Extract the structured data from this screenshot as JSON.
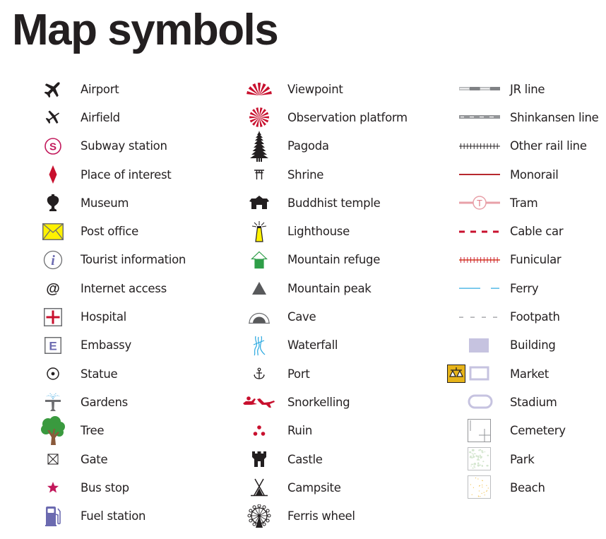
{
  "title": "Map symbols",
  "colors": {
    "text": "#231f20",
    "red": "#c8102e",
    "crimson": "#c2185b",
    "purple": "#6b6ab0",
    "lavender": "#c6c3e0",
    "yellow": "#fff200",
    "green": "#2e9e48",
    "blue": "#29a8e0",
    "gold": "#e6b319"
  },
  "columns": [
    {
      "items": [
        {
          "icon": "airport-icon",
          "label": "Airport"
        },
        {
          "icon": "airfield-icon",
          "label": "Airfield"
        },
        {
          "icon": "subway-station-icon",
          "label": "Subway station"
        },
        {
          "icon": "place-of-interest-icon",
          "label": "Place of interest"
        },
        {
          "icon": "museum-icon",
          "label": "Museum"
        },
        {
          "icon": "post-office-icon",
          "label": "Post office"
        },
        {
          "icon": "tourist-information-icon",
          "label": "Tourist information"
        },
        {
          "icon": "internet-access-icon",
          "label": "Internet access"
        },
        {
          "icon": "hospital-icon",
          "label": "Hospital"
        },
        {
          "icon": "embassy-icon",
          "label": "Embassy"
        },
        {
          "icon": "statue-icon",
          "label": "Statue"
        },
        {
          "icon": "gardens-icon",
          "label": "Gardens"
        },
        {
          "icon": "tree-icon",
          "label": "Tree"
        },
        {
          "icon": "gate-icon",
          "label": "Gate"
        },
        {
          "icon": "bus-stop-icon",
          "label": "Bus stop"
        },
        {
          "icon": "fuel-station-icon",
          "label": "Fuel station"
        }
      ]
    },
    {
      "items": [
        {
          "icon": "viewpoint-icon",
          "label": "Viewpoint"
        },
        {
          "icon": "observation-platform-icon",
          "label": "Observation platform"
        },
        {
          "icon": "pagoda-icon",
          "label": "Pagoda"
        },
        {
          "icon": "shrine-icon",
          "label": "Shrine"
        },
        {
          "icon": "buddhist-temple-icon",
          "label": "Buddhist temple"
        },
        {
          "icon": "lighthouse-icon",
          "label": "Lighthouse"
        },
        {
          "icon": "mountain-refuge-icon",
          "label": "Mountain refuge"
        },
        {
          "icon": "mountain-peak-icon",
          "label": "Mountain peak"
        },
        {
          "icon": "cave-icon",
          "label": "Cave"
        },
        {
          "icon": "waterfall-icon",
          "label": "Waterfall"
        },
        {
          "icon": "port-icon",
          "label": "Port"
        },
        {
          "icon": "snorkelling-icon",
          "label": "Snorkelling"
        },
        {
          "icon": "ruin-icon",
          "label": "Ruin"
        },
        {
          "icon": "castle-icon",
          "label": "Castle"
        },
        {
          "icon": "campsite-icon",
          "label": "Campsite"
        },
        {
          "icon": "ferris-wheel-icon",
          "label": "Ferris wheel"
        }
      ]
    },
    {
      "items": [
        {
          "icon": "jr-line-icon",
          "label": "JR line"
        },
        {
          "icon": "shinkansen-line-icon",
          "label": "Shinkansen line"
        },
        {
          "icon": "other-rail-line-icon",
          "label": "Other rail line"
        },
        {
          "icon": "monorail-icon",
          "label": "Monorail"
        },
        {
          "icon": "tram-icon",
          "label": "Tram",
          "glyph": "T"
        },
        {
          "icon": "cable-car-icon",
          "label": "Cable car"
        },
        {
          "icon": "funicular-icon",
          "label": "Funicular"
        },
        {
          "icon": "ferry-icon",
          "label": "Ferry"
        },
        {
          "icon": "footpath-icon",
          "label": "Footpath"
        },
        {
          "icon": "building-icon",
          "label": "Building"
        },
        {
          "icon": "market-icon",
          "label": "Market"
        },
        {
          "icon": "stadium-icon",
          "label": "Stadium"
        },
        {
          "icon": "cemetery-icon",
          "label": "Cemetery"
        },
        {
          "icon": "park-icon",
          "label": "Park"
        },
        {
          "icon": "beach-icon",
          "label": "Beach"
        }
      ]
    }
  ],
  "icon_glyphs": {
    "subway": "S",
    "info": "i",
    "internet": "@",
    "embassy": "E"
  }
}
